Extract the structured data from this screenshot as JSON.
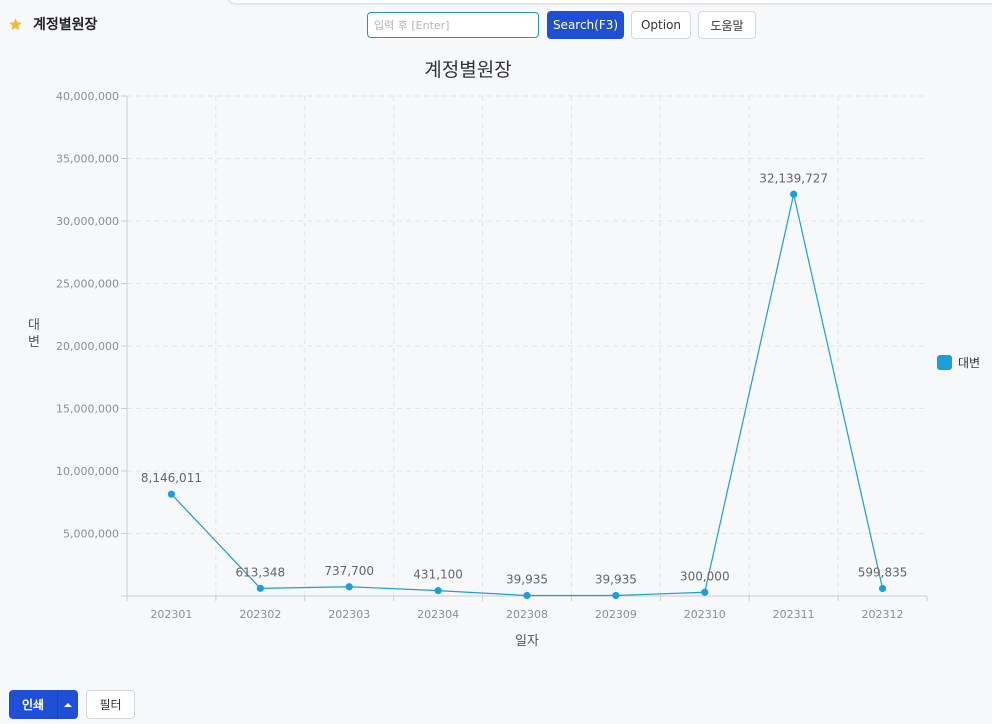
{
  "header": {
    "title": "계정별원장"
  },
  "toolbar": {
    "search_placeholder": "입력 후 [Enter]",
    "search_value": "",
    "search_label": "Search(F3)",
    "option_label": "Option",
    "help_label": "도움말"
  },
  "footer": {
    "print_label": "인쇄",
    "filter_label": "필터"
  },
  "colors": {
    "accent": "#1f4fd6",
    "series": "#1a9fdb",
    "star": "#f5b82e"
  },
  "icons": [
    "star-icon",
    "caret-up-icon"
  ],
  "chart_data": {
    "type": "line",
    "title": "계정별원장",
    "xlabel": "일자",
    "ylabel": "대변",
    "categories": [
      "202301",
      "202302",
      "202303",
      "202304",
      "202308",
      "202309",
      "202310",
      "202311",
      "202312"
    ],
    "series": [
      {
        "name": "대변",
        "values": [
          8146011,
          613348,
          737700,
          431100,
          39935,
          39935,
          300000,
          32139727,
          599835
        ],
        "labels": [
          "8,146,011",
          "613,348",
          "737,700",
          "431,100",
          "39,935",
          "39,935",
          "300,000",
          "32,139,727",
          "599,835"
        ]
      }
    ],
    "ylim": [
      0,
      40000000
    ],
    "yticks": [
      0,
      5000000,
      10000000,
      15000000,
      20000000,
      25000000,
      30000000,
      35000000,
      40000000
    ],
    "ytick_labels": [
      "",
      "5,000,000",
      "10,000,000",
      "15,000,000",
      "20,000,000",
      "25,000,000",
      "30,000,000",
      "35,000,000",
      "40,000,000"
    ],
    "grid": true,
    "legend": "right"
  }
}
